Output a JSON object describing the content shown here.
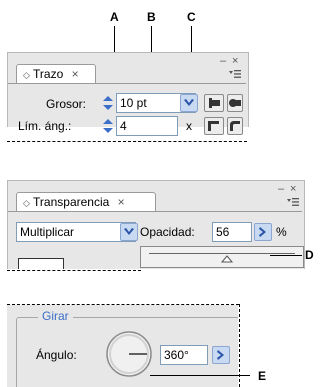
{
  "callouts": {
    "a": "A",
    "b": "B",
    "c": "C",
    "d": "D",
    "e": "E"
  },
  "trazo": {
    "tab_label": "Trazo",
    "tab_close": "×",
    "minimize": "–",
    "close": "×",
    "grosor_label": "Grosor:",
    "grosor_value": "10 pt",
    "lim_label": "Lím. áng.:",
    "lim_value": "4",
    "lim_unit": "x"
  },
  "transparencia": {
    "tab_label": "Transparencia",
    "tab_close": "×",
    "minimize": "–",
    "close": "×",
    "blend_mode": "Multiplicar",
    "opacity_label": "Opacidad:",
    "opacity_value": "56",
    "opacity_unit": "%"
  },
  "girar": {
    "group_title": "Girar",
    "angle_label": "Ángulo:",
    "angle_value": "360°"
  },
  "colors": {
    "accent": "#3c6fc8",
    "panel": "#e7e7e7",
    "field_border": "#7f9db9"
  }
}
